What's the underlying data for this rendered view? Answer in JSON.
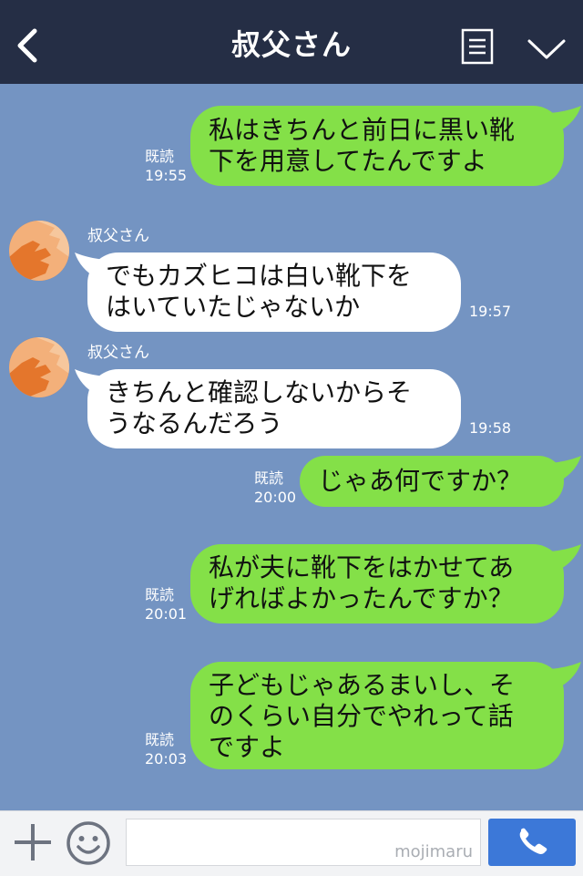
{
  "header": {
    "title": "叔父さん",
    "back_icon": "chevron-left-icon",
    "menu_icon": "notes-icon",
    "expand_icon": "chevron-down-icon"
  },
  "messages": [
    {
      "dir": "out",
      "text": "私はきちんと前日に黒い靴\n下を用意してたんですよ",
      "read": "既読",
      "time": "19:55"
    },
    {
      "dir": "in",
      "sender": "叔父さん",
      "text": "でもカズヒコは白い靴下を\nはいていたじゃないか",
      "time": "19:57"
    },
    {
      "dir": "in",
      "sender": "叔父さん",
      "text": "きちんと確認しないからそ\nうなるんだろう",
      "time": "19:58"
    },
    {
      "dir": "out",
      "text": "じゃあ何ですか？",
      "read": "既読",
      "time": "20:00"
    },
    {
      "dir": "out",
      "text": "私が夫に靴下をはかせてあ\nげればよかったんですか？",
      "read": "既読",
      "time": "20:01"
    },
    {
      "dir": "out",
      "text": "子どもじゃあるまいし、そ\nのくらい自分でやれって話\nですよ",
      "read": "既読",
      "time": "20:03"
    }
  ],
  "footer": {
    "input_value": "",
    "watermark": "mojimaru",
    "plus_icon": "plus-icon",
    "emoji_icon": "smiley-icon",
    "call_icon": "phone-icon"
  },
  "colors": {
    "header_bg": "#252e45",
    "chat_bg": "#7494c2",
    "out_bubble": "#84e048",
    "in_bubble": "#ffffff",
    "call_button": "#3c78d8"
  }
}
